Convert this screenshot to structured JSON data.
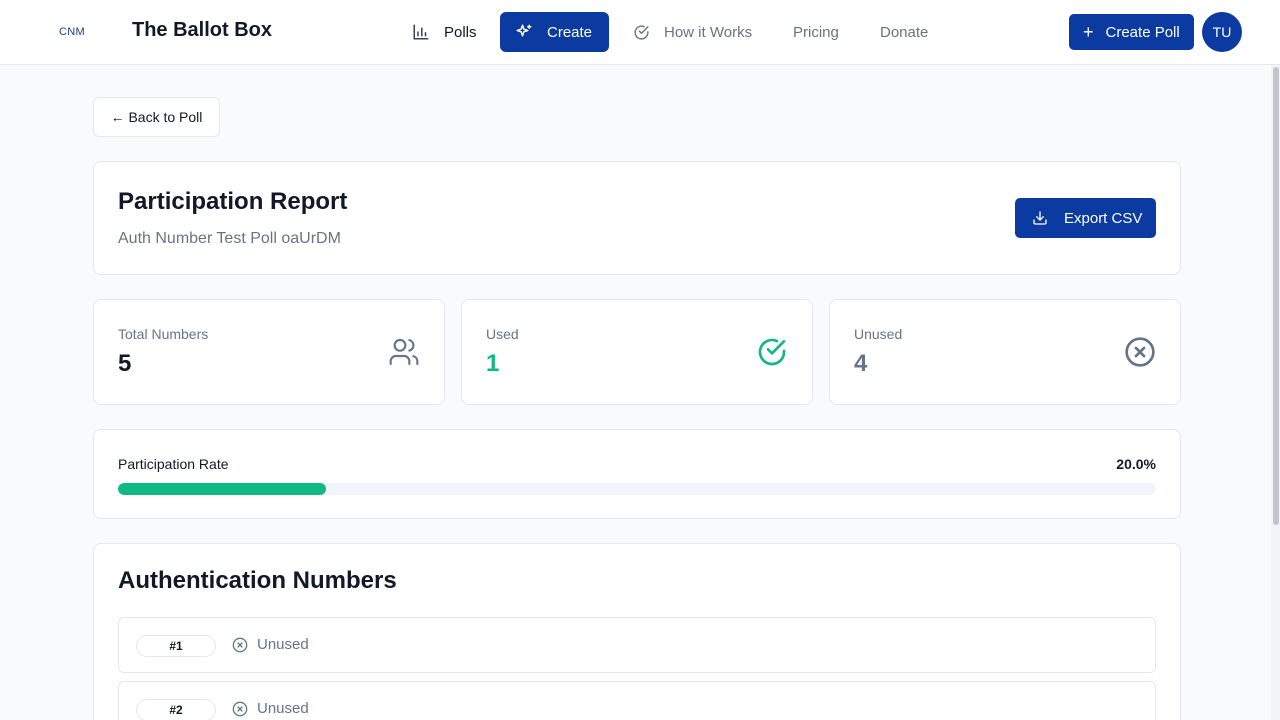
{
  "header": {
    "logo_text": "CNM",
    "brand": "The Ballot Box",
    "nav": [
      {
        "label": "Polls",
        "icon": "bar-chart-icon"
      },
      {
        "label": "Create",
        "icon": "sparkles-icon",
        "active": true
      },
      {
        "label": "How it Works",
        "icon": "check-circle-icon"
      },
      {
        "label": "Pricing"
      },
      {
        "label": "Donate"
      }
    ],
    "create_poll_label": "Create Poll",
    "avatar_initials": "TU"
  },
  "back_label": "← Back to Poll",
  "report": {
    "title": "Participation Report",
    "subtitle": "Auth Number Test Poll oaUrDM",
    "export_label": "Export CSV"
  },
  "stats": {
    "total": {
      "label": "Total Numbers",
      "value": "5",
      "icon": "users-icon"
    },
    "used": {
      "label": "Used",
      "value": "1",
      "icon": "check-circle-icon"
    },
    "unused": {
      "label": "Unused",
      "value": "4",
      "icon": "x-circle-icon"
    }
  },
  "participation": {
    "label": "Participation Rate",
    "value_text": "20.0%",
    "fraction": 0.2
  },
  "auth": {
    "title": "Authentication Numbers",
    "rows": [
      {
        "number": "#1",
        "status": "Unused"
      },
      {
        "number": "#2",
        "status": "Unused"
      }
    ]
  },
  "colors": {
    "primary": "#0b3aa0",
    "success": "#10b981",
    "muted": "#64748b"
  }
}
